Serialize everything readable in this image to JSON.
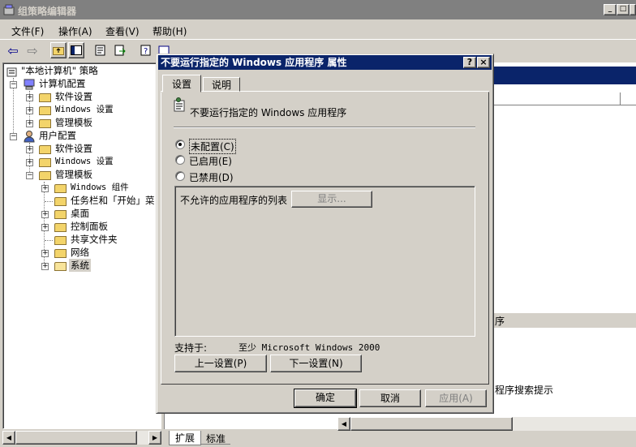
{
  "window": {
    "title": "组策略编辑器",
    "min": "_",
    "max": "□",
    "close": "×"
  },
  "menu": [
    "文件(F)",
    "操作(A)",
    "查看(V)",
    "帮助(H)"
  ],
  "toolbar": {
    "icons": [
      "back-arrow-icon",
      "forward-arrow-icon",
      "up-folder-icon",
      "show-hide-tree-icon",
      "properties-icon",
      "export-list-icon",
      "help-icon",
      "console-icon"
    ],
    "back": "⇦",
    "forward": "⇨"
  },
  "tree": {
    "root": "\"本地计算机\" 策略",
    "items": [
      {
        "label": "计算机配置"
      },
      {
        "label": "软件设置"
      },
      {
        "label": "Windows 设置"
      },
      {
        "label": "管理模板"
      },
      {
        "label": "用户配置"
      },
      {
        "label": "软件设置"
      },
      {
        "label": "Windows 设置"
      },
      {
        "label": "管理模板"
      },
      {
        "label": "Windows 组件"
      },
      {
        "label": "任务栏和「开始」菜"
      },
      {
        "label": "桌面"
      },
      {
        "label": "控制面板"
      },
      {
        "label": "共享文件夹"
      },
      {
        "label": "网络"
      },
      {
        "label": "系统"
      }
    ]
  },
  "rightpane": {
    "partial_text_1": "序",
    "partial_text_2": "程序搜索提示",
    "tabs": [
      "扩展",
      "标准"
    ]
  },
  "dialog": {
    "title": "不要运行指定的 Windows 应用程序 属性",
    "help": "?",
    "close": "×",
    "tabs": [
      "设置",
      "说明"
    ],
    "policy_name": "不要运行指定的 Windows 应用程序",
    "options": [
      {
        "label": "未配置(C)",
        "selected": true
      },
      {
        "label": "已启用(E)",
        "selected": false
      },
      {
        "label": "已禁用(D)",
        "selected": false
      }
    ],
    "list_label": "不允许的应用程序的列表",
    "show_button": "显示...",
    "supported_label": "支持于:",
    "supported_value": "至少 Microsoft Windows 2000",
    "prev_button": "上一设置(P)",
    "next_button": "下一设置(N)",
    "ok": "确定",
    "cancel": "取消",
    "apply": "应用(A)"
  }
}
